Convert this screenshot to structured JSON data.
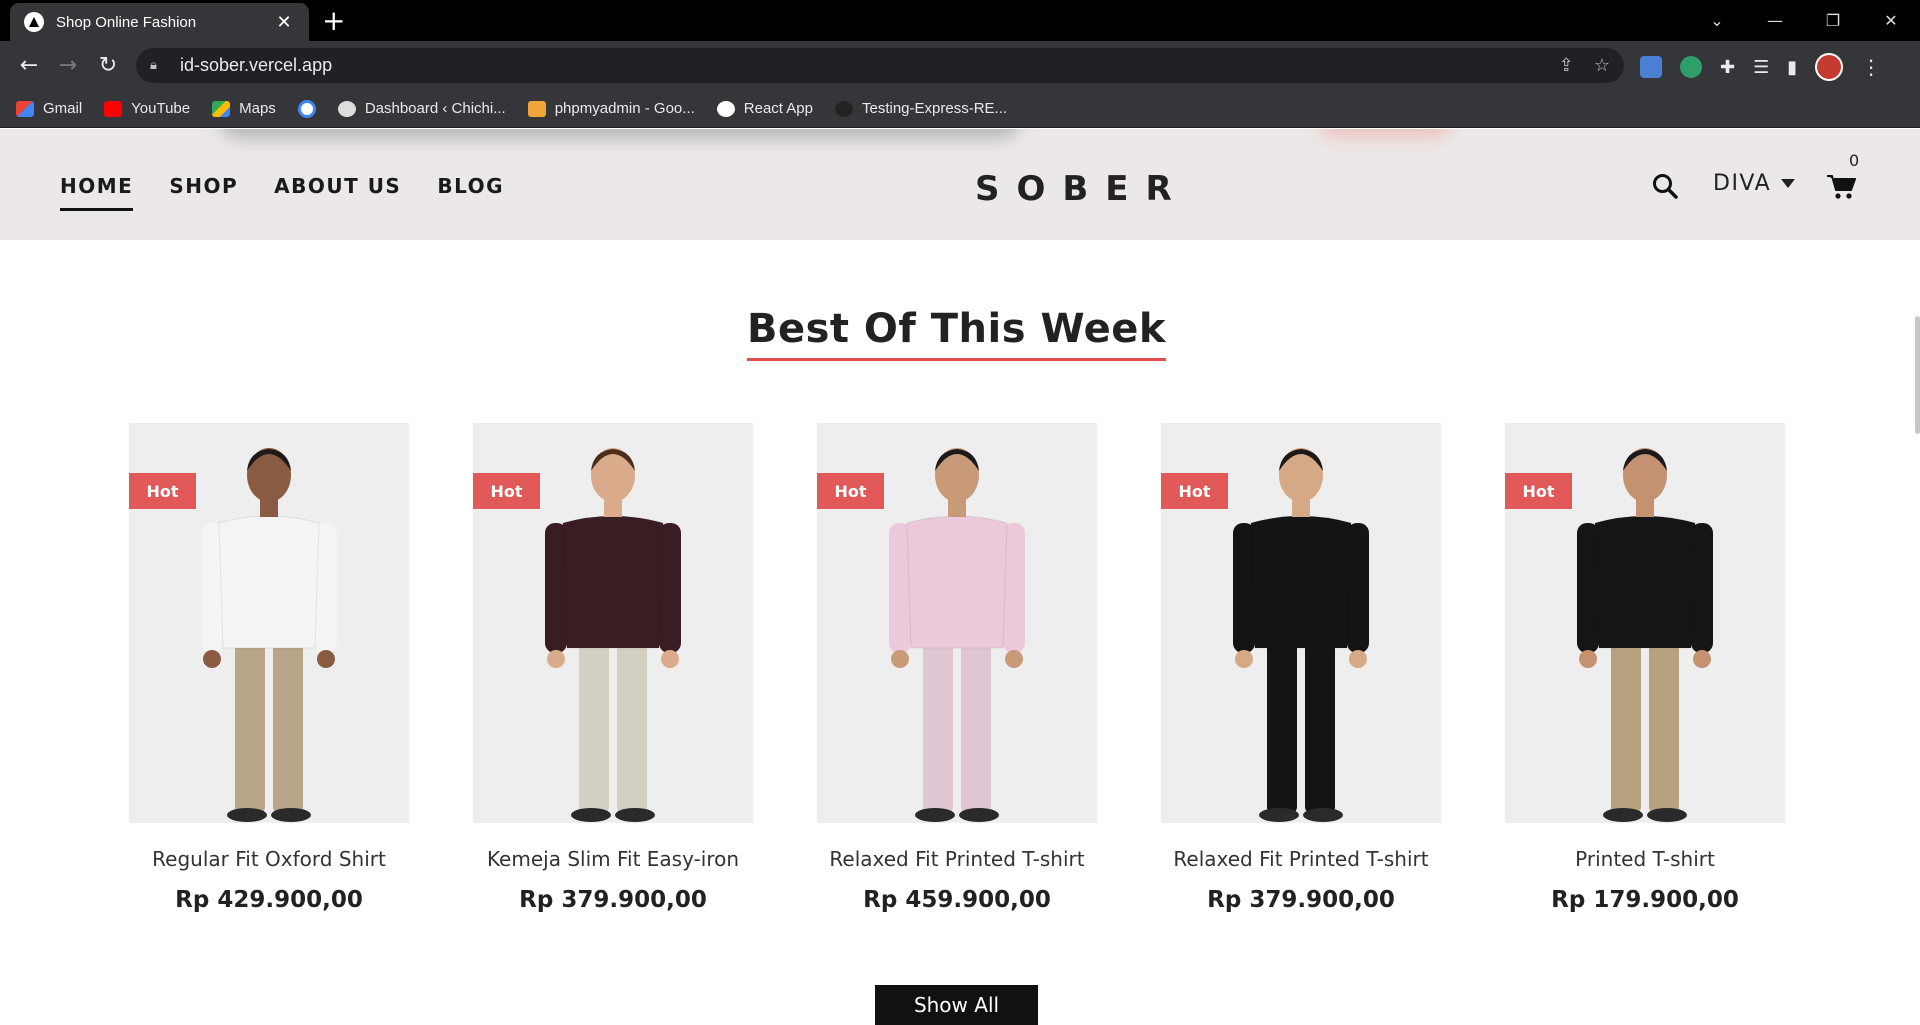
{
  "browser": {
    "tab_title": "Shop Online Fashion",
    "url": "id-sober.vercel.app",
    "bookmarks": [
      {
        "label": "Gmail",
        "icon": "gmail-icon"
      },
      {
        "label": "YouTube",
        "icon": "youtube-icon"
      },
      {
        "label": "Maps",
        "icon": "maps-icon"
      },
      {
        "label": "",
        "icon": "google-icon"
      },
      {
        "label": "Dashboard ‹ Chichi...",
        "icon": "wordpress-icon"
      },
      {
        "label": "phpmyadmin - Goo...",
        "icon": "phpmyadmin-icon"
      },
      {
        "label": "React App",
        "icon": "react-app-icon"
      },
      {
        "label": "Testing-Express-RE...",
        "icon": "github-icon"
      }
    ]
  },
  "header": {
    "nav": [
      "HOME",
      "SHOP",
      "ABOUT US",
      "BLOG"
    ],
    "logo": "SOBER",
    "user": "DIVA",
    "cart_count": "0"
  },
  "section": {
    "title": "Best Of This Week",
    "show_all": "Show All"
  },
  "products": [
    {
      "badge": "Hot",
      "name": "Regular Fit Oxford Shirt",
      "price": "Rp 429.900,00",
      "shirt": "#f4f4f2",
      "pants": "#b8a58a",
      "skin": "#8a5b43",
      "hair": "#1e1a18"
    },
    {
      "badge": "Hot",
      "name": "Kemeja Slim Fit Easy-iron",
      "price": "Rp 379.900,00",
      "shirt": "#3a1d22",
      "pants": "#d4cfc3",
      "skin": "#d9ab8a",
      "hair": "#4a2e1d"
    },
    {
      "badge": "Hot",
      "name": "Relaxed Fit Printed T-shirt",
      "price": "Rp 459.900,00",
      "shirt": "#e9c9da",
      "pants": "#e0c6d3",
      "skin": "#c99a78",
      "hair": "#1a1a1a"
    },
    {
      "badge": "Hot",
      "name": "Relaxed Fit Printed T-shirt",
      "price": "Rp 379.900,00",
      "shirt": "#141414",
      "pants": "#141414",
      "skin": "#d5a886",
      "hair": "#1c1917"
    },
    {
      "badge": "Hot",
      "name": "Printed T-shirt",
      "price": "Rp 179.900,00",
      "shirt": "#151515",
      "pants": "#b7a17e",
      "skin": "#c49270",
      "hair": "#1a1a1a"
    }
  ],
  "colors": {
    "accent": "#e14d4d",
    "badge": "#e15959",
    "header_bg": "#ebe8e7"
  }
}
